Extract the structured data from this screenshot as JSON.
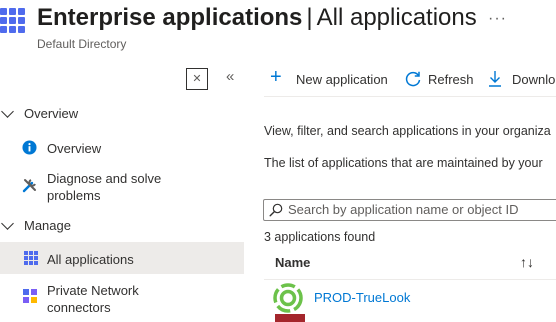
{
  "header": {
    "title_main": "Enterprise applications",
    "title_separator": "|",
    "title_rest": "All applications",
    "subtitle": "Default Directory",
    "more_label": "···"
  },
  "sidebar": {
    "collapse_label": "✕",
    "collapse_nav_label": "«",
    "sections": [
      {
        "label": "Overview",
        "items": [
          {
            "label": "Overview",
            "icon": "info-icon"
          },
          {
            "label": "Diagnose and solve problems",
            "icon": "tools-icon"
          }
        ]
      },
      {
        "label": "Manage",
        "items": [
          {
            "label": "All applications",
            "icon": "grid-apps-icon",
            "selected": true
          },
          {
            "label": "Private Network connectors",
            "icon": "network-connector-icon"
          }
        ]
      }
    ]
  },
  "toolbar": {
    "new_application": "New application",
    "refresh": "Refresh",
    "download": "Downlo"
  },
  "main": {
    "description": "View, filter, and search applications in your organiza",
    "list_note": "The list of applications that are maintained by your",
    "search_placeholder": "Search by application name or object ID",
    "results_count": "3 applications found",
    "column_name": "Name",
    "rows": [
      {
        "name": "PROD-TrueLook",
        "icon": "truelook-logo-icon",
        "icon_color": "#6cc24a"
      },
      {
        "name": "",
        "icon": "app-logo-icon",
        "icon_color": "#a4262c"
      }
    ]
  },
  "colors": {
    "accent": "#0078d4",
    "selected_bg": "#edebe9",
    "brand_grid": "#4f6bed"
  }
}
